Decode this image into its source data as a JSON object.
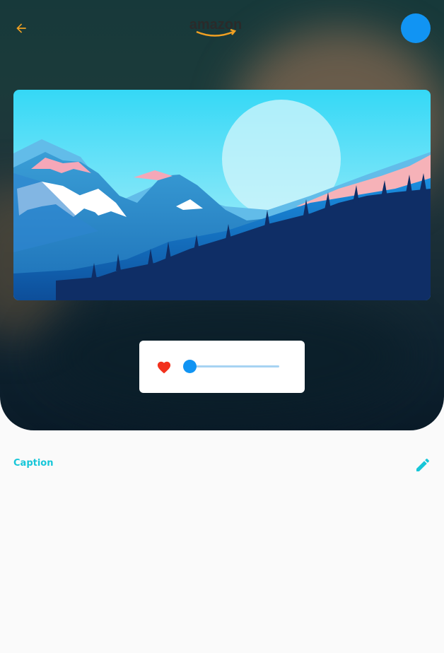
{
  "header": {
    "back_icon": "arrow-back-icon",
    "logo_text": "amazon",
    "action_button_color": "#1194f3"
  },
  "image": {
    "description_icon": "mountain-landscape-illustration"
  },
  "player": {
    "like_icon": "heart-icon",
    "like_color": "#f2311d",
    "progress": 0.05,
    "accent_color": "#1194f3"
  },
  "caption": {
    "label": "Caption",
    "edit_icon": "pencil-icon",
    "accent_color": "#16c6d8"
  }
}
